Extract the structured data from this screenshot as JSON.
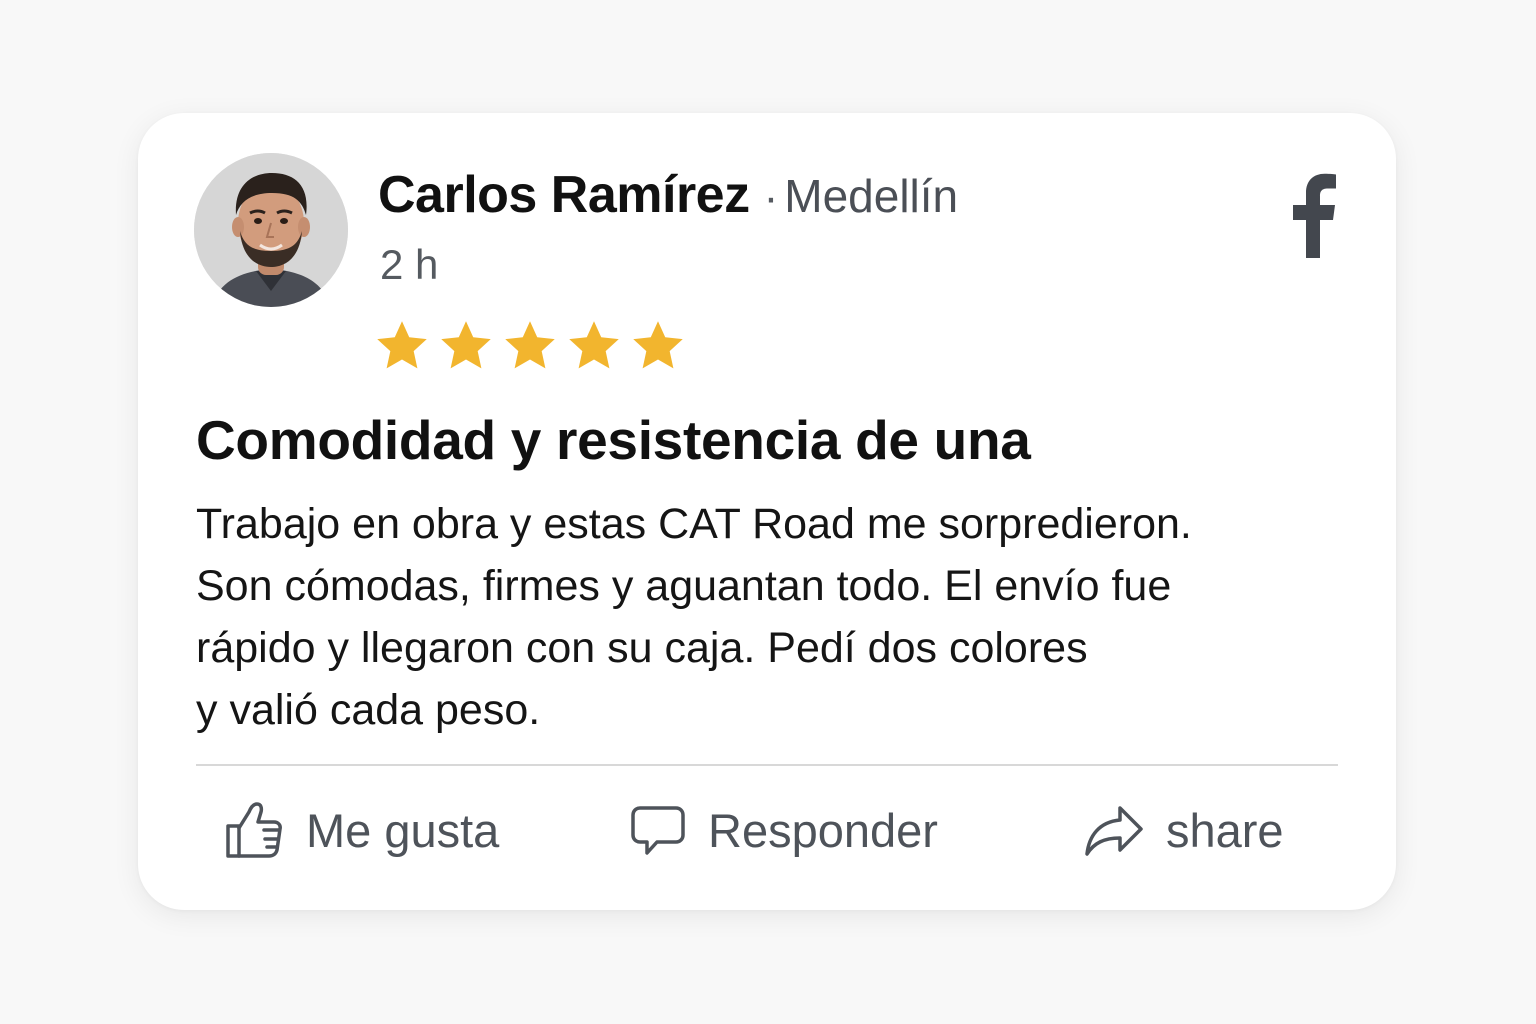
{
  "post": {
    "author": "Carlos Ramírez",
    "separator": "·",
    "location": "Medellín",
    "time": "2 h",
    "platform_icon": "facebook-logo-icon",
    "rating": 5,
    "rating_max": 5,
    "star_color": "#F2B52E",
    "title": "Comodidad y resistencia de una",
    "body_lines": [
      "Trabajo en obra y estas CAT Road me sorpredieron.",
      "Son cómodas, firmes y aguantan todo. El envío fue",
      "rápido y llegaron con su caja. Pedí dos colores",
      "y valió cada peso."
    ]
  },
  "actions": {
    "like": {
      "label": "Me gusta",
      "icon": "thumbs-up-icon"
    },
    "reply": {
      "label": "Responder",
      "icon": "comment-icon"
    },
    "share": {
      "label": "share",
      "icon": "share-arrow-icon"
    }
  }
}
